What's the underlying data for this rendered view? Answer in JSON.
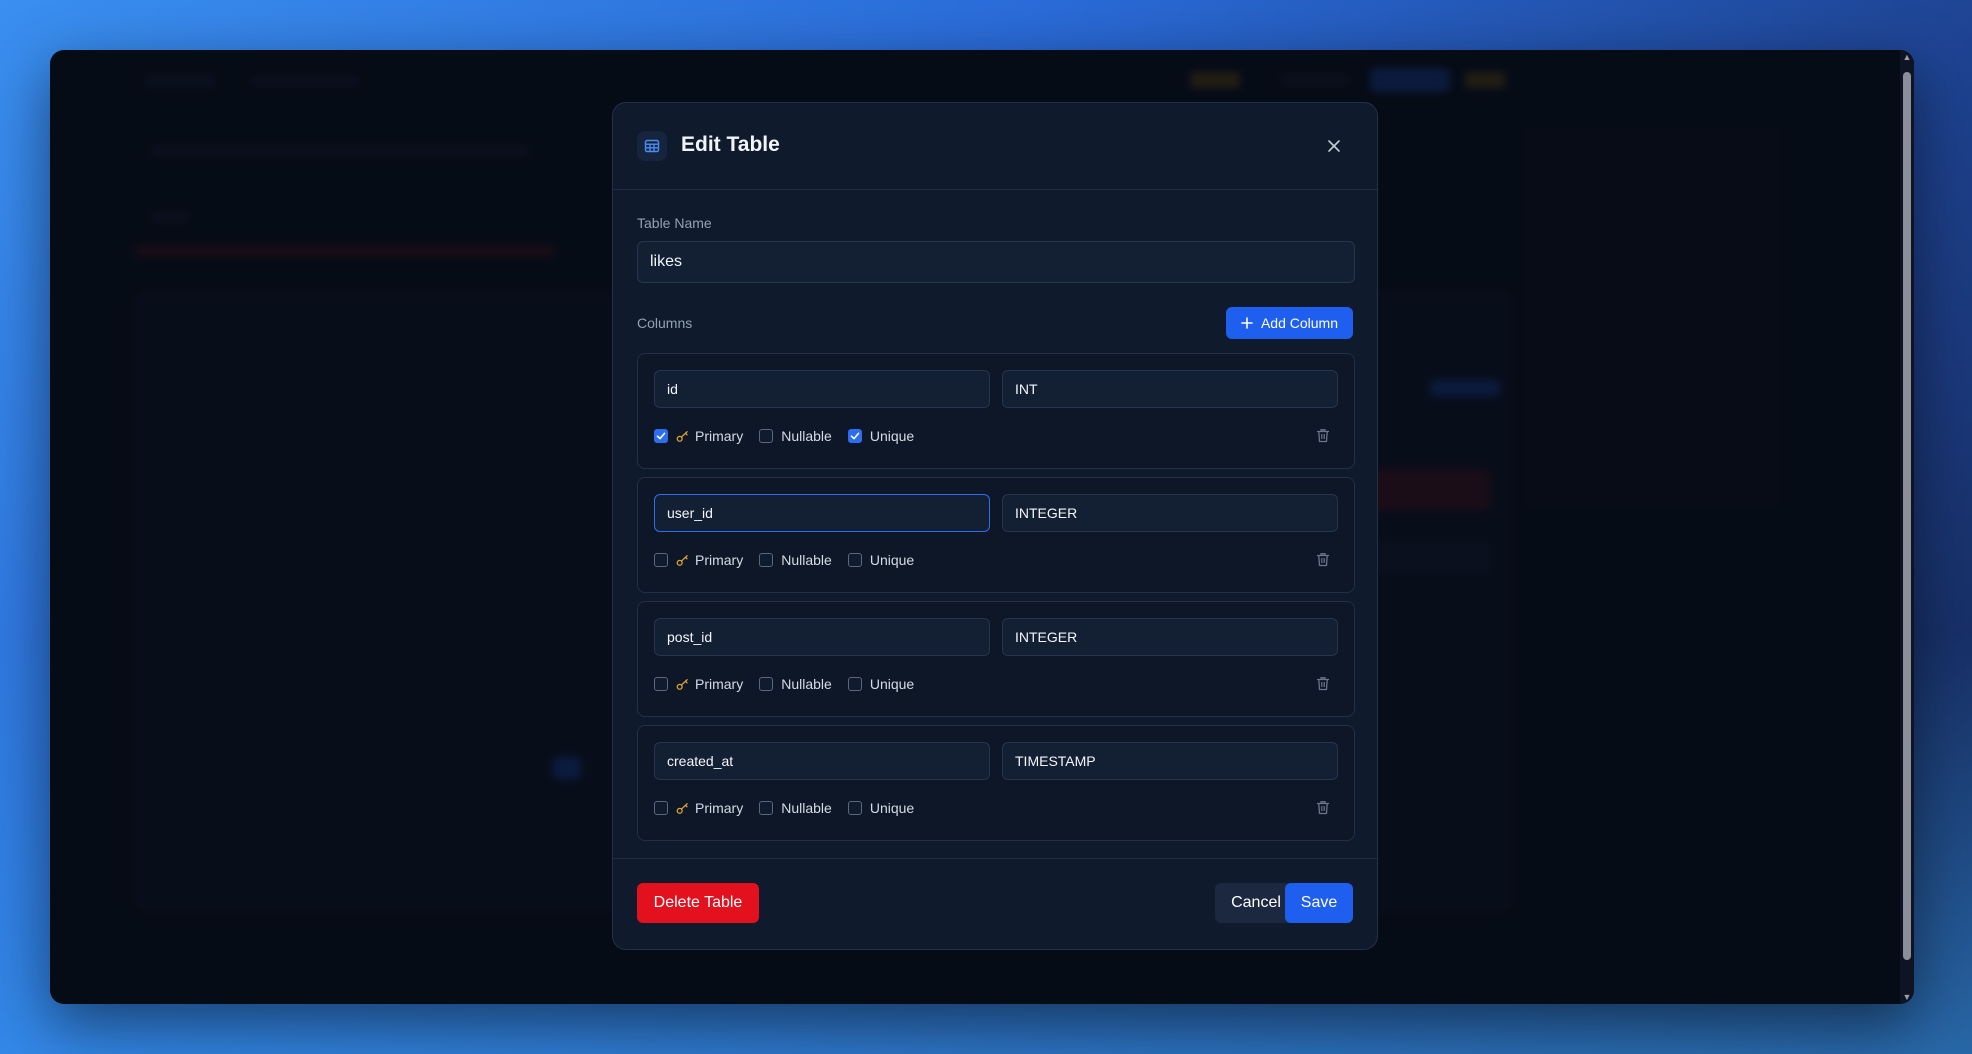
{
  "modal": {
    "title": "Edit Table",
    "table_name_label": "Table Name",
    "table_name_value": "likes",
    "columns_label": "Columns",
    "add_column_label": "Add Column",
    "columns": [
      {
        "name": "id",
        "type": "INT",
        "primary": true,
        "nullable": false,
        "unique": true
      },
      {
        "name": "user_id",
        "type": "INTEGER",
        "primary": false,
        "nullable": false,
        "unique": false
      },
      {
        "name": "post_id",
        "type": "INTEGER",
        "primary": false,
        "nullable": false,
        "unique": false
      },
      {
        "name": "created_at",
        "type": "TIMESTAMP",
        "primary": false,
        "nullable": false,
        "unique": false
      }
    ],
    "option_labels": {
      "primary": "Primary",
      "nullable": "Nullable",
      "unique": "Unique"
    },
    "footer": {
      "delete_label": "Delete Table",
      "cancel_label": "Cancel",
      "save_label": "Save"
    }
  },
  "colors": {
    "accent": "#1f5ff0",
    "danger": "#e3101d",
    "key": "#e0a530"
  },
  "icons": {
    "header": "table-icon",
    "close": "close-icon",
    "add": "plus-icon",
    "key": "key-icon",
    "delete_row": "trash-icon",
    "check": "checkmark-icon"
  }
}
